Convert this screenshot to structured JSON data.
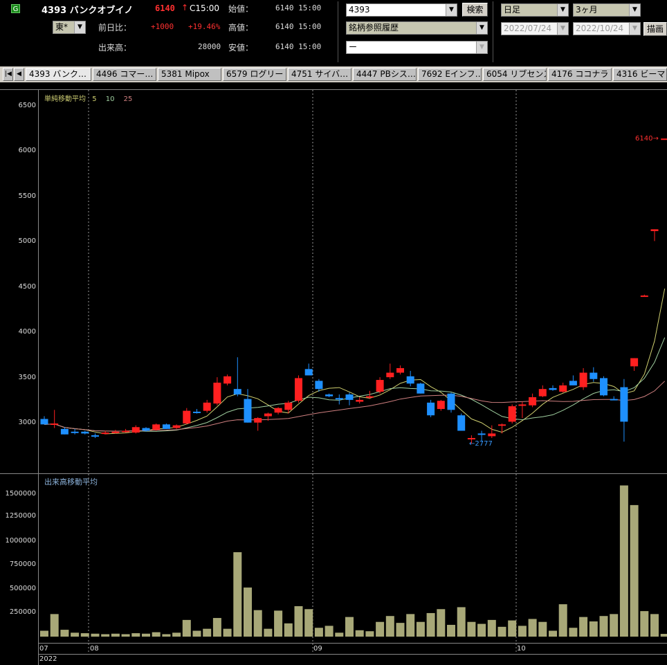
{
  "header": {
    "market_icon": "G",
    "code_name": "4393 バンクオブイノ",
    "price": "6140",
    "price_arrow": "↑",
    "price_time": "C15:00",
    "exchange": "東*",
    "change_label": "前日比：",
    "change_value": "+1000",
    "change_pct": "+19.46%",
    "volume_label": "出来高：",
    "volume_value": "28000",
    "open_label": "始値：",
    "open_value": "6140 15:00",
    "high_label": "高値：",
    "high_value": "6140 15:00",
    "low_label": "安値：",
    "low_value": "6140 15:00"
  },
  "controls": {
    "code_input": "4393",
    "search_button": "検索",
    "history_select": "銘柄参照履歴",
    "blank_select": "ー",
    "period_select": "日足",
    "range_select": "3ヶ月",
    "date_from": "2022/07/24",
    "date_to": "2022/10/24",
    "draw_button": "描画"
  },
  "tabs": {
    "first_icon": "first-page-icon",
    "prev_icon": "prev-page-icon",
    "items": [
      "4393 バンク…",
      "4496 コマー…",
      "5381 Mipox",
      "6579 ログリー",
      "4751 サイバ…",
      "4447 PBシス…",
      "7692 Eインフ…",
      "6054 リブセンス",
      "4176 ココナラ",
      "4316 ビーマッ"
    ]
  },
  "colors": {
    "up": "#ff2020",
    "down": "#1e90ff",
    "ma5": "#d0d070",
    "ma10": "#a0d0a0",
    "ma25": "#d08080",
    "volume": "#a8a878"
  },
  "price_panel": {
    "legend_label": "単純移動平均",
    "ma_periods": [
      "5",
      "10",
      "25"
    ],
    "y_ticks": [
      "6500",
      "6000",
      "5500",
      "5000",
      "4500",
      "4000",
      "3500",
      "3000"
    ],
    "last_price_marker": "6140→",
    "low_marker": "←2777"
  },
  "volume_panel": {
    "legend_label": "出来高移動平均",
    "y_ticks": [
      "1500000",
      "1250000",
      "1000000",
      "750000",
      "500000",
      "250000"
    ]
  },
  "x_axis": {
    "labels": [
      "07",
      "08",
      "09",
      "10"
    ],
    "year": "2022"
  },
  "chart_data": {
    "type": "candlestick",
    "ylim": [
      2500,
      6700
    ],
    "volume_ylim": [
      0,
      1600000
    ],
    "candles": [
      {
        "o": 3050,
        "h": 3080,
        "l": 2990,
        "c": 2990,
        "v": 60000
      },
      {
        "o": 3000,
        "h": 3150,
        "l": 2950,
        "c": 3000,
        "v": 230000
      },
      {
        "o": 2940,
        "h": 2960,
        "l": 2880,
        "c": 2880,
        "v": 70000
      },
      {
        "o": 2910,
        "h": 2940,
        "l": 2880,
        "c": 2900,
        "v": 40000
      },
      {
        "o": 2910,
        "h": 2920,
        "l": 2880,
        "c": 2890,
        "v": 35000
      },
      {
        "o": 2870,
        "h": 2890,
        "l": 2840,
        "c": 2860,
        "v": 30000
      },
      {
        "o": 2900,
        "h": 2920,
        "l": 2880,
        "c": 2900,
        "v": 25000
      },
      {
        "o": 2910,
        "h": 2930,
        "l": 2890,
        "c": 2910,
        "v": 30000
      },
      {
        "o": 2920,
        "h": 2940,
        "l": 2900,
        "c": 2920,
        "v": 25000
      },
      {
        "o": 2900,
        "h": 2980,
        "l": 2890,
        "c": 2960,
        "v": 35000
      },
      {
        "o": 2950,
        "h": 2960,
        "l": 2910,
        "c": 2920,
        "v": 30000
      },
      {
        "o": 2930,
        "h": 3000,
        "l": 2920,
        "c": 2990,
        "v": 45000
      },
      {
        "o": 2990,
        "h": 3000,
        "l": 2940,
        "c": 2940,
        "v": 25000
      },
      {
        "o": 2950,
        "h": 2990,
        "l": 2940,
        "c": 2980,
        "v": 40000
      },
      {
        "o": 3000,
        "h": 3170,
        "l": 2990,
        "c": 3140,
        "v": 170000
      },
      {
        "o": 3130,
        "h": 3160,
        "l": 3110,
        "c": 3120,
        "v": 60000
      },
      {
        "o": 3140,
        "h": 3260,
        "l": 3120,
        "c": 3230,
        "v": 80000
      },
      {
        "o": 3220,
        "h": 3510,
        "l": 3200,
        "c": 3450,
        "v": 190000
      },
      {
        "o": 3440,
        "h": 3540,
        "l": 3420,
        "c": 3520,
        "v": 80000
      },
      {
        "o": 3380,
        "h": 3730,
        "l": 3300,
        "c": 3320,
        "v": 860000
      },
      {
        "o": 3270,
        "h": 3380,
        "l": 3010,
        "c": 3010,
        "v": 500000
      },
      {
        "o": 3010,
        "h": 3070,
        "l": 2920,
        "c": 3060,
        "v": 270000
      },
      {
        "o": 3080,
        "h": 3120,
        "l": 3030,
        "c": 3110,
        "v": 80000
      },
      {
        "o": 3120,
        "h": 3180,
        "l": 3100,
        "c": 3170,
        "v": 265000
      },
      {
        "o": 3150,
        "h": 3250,
        "l": 3110,
        "c": 3230,
        "v": 135000
      },
      {
        "o": 3250,
        "h": 3530,
        "l": 3230,
        "c": 3500,
        "v": 310000
      },
      {
        "o": 3600,
        "h": 3660,
        "l": 3530,
        "c": 3530,
        "v": 280000
      },
      {
        "o": 3470,
        "h": 3490,
        "l": 3350,
        "c": 3380,
        "v": 90000
      },
      {
        "o": 3320,
        "h": 3330,
        "l": 3290,
        "c": 3300,
        "v": 110000
      },
      {
        "o": 3280,
        "h": 3320,
        "l": 3210,
        "c": 3270,
        "v": 40000
      },
      {
        "o": 3320,
        "h": 3340,
        "l": 3200,
        "c": 3260,
        "v": 200000
      },
      {
        "o": 3240,
        "h": 3290,
        "l": 3220,
        "c": 3260,
        "v": 65000
      },
      {
        "o": 3300,
        "h": 3360,
        "l": 3270,
        "c": 3300,
        "v": 55000
      },
      {
        "o": 3350,
        "h": 3510,
        "l": 3330,
        "c": 3480,
        "v": 150000
      },
      {
        "o": 3510,
        "h": 3660,
        "l": 3490,
        "c": 3560,
        "v": 210000
      },
      {
        "o": 3560,
        "h": 3640,
        "l": 3540,
        "c": 3610,
        "v": 140000
      },
      {
        "o": 3520,
        "h": 3580,
        "l": 3410,
        "c": 3440,
        "v": 230000
      },
      {
        "o": 3440,
        "h": 3450,
        "l": 3330,
        "c": 3330,
        "v": 150000
      },
      {
        "o": 3230,
        "h": 3260,
        "l": 3070,
        "c": 3090,
        "v": 240000
      },
      {
        "o": 3160,
        "h": 3260,
        "l": 3140,
        "c": 3250,
        "v": 280000
      },
      {
        "o": 3330,
        "h": 3340,
        "l": 3120,
        "c": 3150,
        "v": 120000
      },
      {
        "o": 3090,
        "h": 3110,
        "l": 2920,
        "c": 2920,
        "v": 300000
      },
      {
        "o": 2840,
        "h": 2870,
        "l": 2777,
        "c": 2840,
        "v": 150000
      },
      {
        "o": 2890,
        "h": 2920,
        "l": 2800,
        "c": 2880,
        "v": 130000
      },
      {
        "o": 2860,
        "h": 2980,
        "l": 2840,
        "c": 2890,
        "v": 170000
      },
      {
        "o": 2980,
        "h": 3000,
        "l": 2890,
        "c": 2990,
        "v": 100000
      },
      {
        "o": 3020,
        "h": 3210,
        "l": 3000,
        "c": 3190,
        "v": 165000
      },
      {
        "o": 3200,
        "h": 3240,
        "l": 3060,
        "c": 3210,
        "v": 110000
      },
      {
        "o": 3200,
        "h": 3330,
        "l": 3180,
        "c": 3290,
        "v": 180000
      },
      {
        "o": 3300,
        "h": 3420,
        "l": 3290,
        "c": 3380,
        "v": 150000
      },
      {
        "o": 3390,
        "h": 3420,
        "l": 3360,
        "c": 3370,
        "v": 60000
      },
      {
        "o": 3350,
        "h": 3450,
        "l": 3340,
        "c": 3420,
        "v": 330000
      },
      {
        "o": 3470,
        "h": 3530,
        "l": 3420,
        "c": 3420,
        "v": 90000
      },
      {
        "o": 3400,
        "h": 3610,
        "l": 3370,
        "c": 3560,
        "v": 200000
      },
      {
        "o": 3560,
        "h": 3620,
        "l": 3460,
        "c": 3490,
        "v": 155000
      },
      {
        "o": 3500,
        "h": 3520,
        "l": 3300,
        "c": 3310,
        "v": 210000
      },
      {
        "o": 3270,
        "h": 3300,
        "l": 3260,
        "c": 3260,
        "v": 230000
      },
      {
        "o": 3400,
        "h": 3490,
        "l": 2800,
        "c": 3020,
        "v": 1540000
      },
      {
        "o": 3630,
        "h": 3720,
        "l": 3580,
        "c": 3720,
        "v": 1340000
      },
      {
        "o": 4400,
        "h": 4420,
        "l": 4400,
        "c": 4410,
        "v": 260000
      },
      {
        "o": 5120,
        "h": 5140,
        "l": 5010,
        "c": 5140,
        "v": 230000
      },
      {
        "o": 6140,
        "h": 6140,
        "l": 6140,
        "c": 6140,
        "v": 28000
      }
    ]
  }
}
